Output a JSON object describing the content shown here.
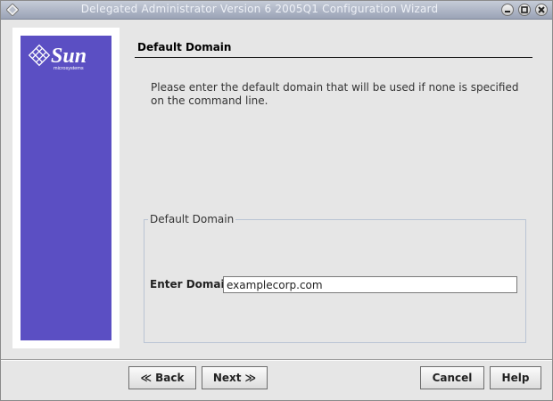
{
  "window": {
    "title": "Delegated Administrator Version 6 2005Q1 Configuration Wizard",
    "icons": [
      "minimize-icon",
      "maximize-icon",
      "close-icon"
    ]
  },
  "sidebar": {
    "logo_text": "Sun",
    "logo_subtext": "microsystems",
    "background_color": "#5b4fc3"
  },
  "panel": {
    "title": "Default Domain",
    "instructions": "Please enter the default domain that will be used if none is specified on the command line.",
    "group_label": "Default Domain",
    "field_label": "Enter Domain",
    "field_value": "examplecorp.com"
  },
  "buttons": {
    "back": "Back",
    "next": "Next",
    "cancel": "Cancel",
    "help": "Help"
  }
}
